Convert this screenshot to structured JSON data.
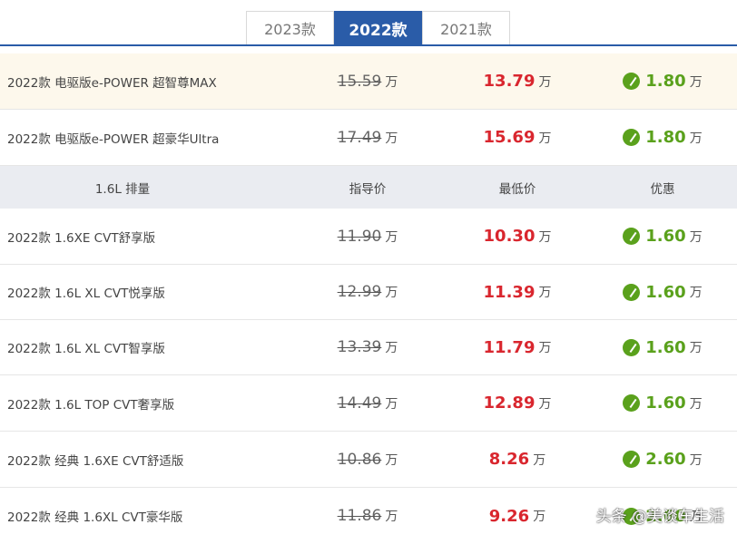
{
  "tabs": [
    {
      "label": "2023款",
      "active": false
    },
    {
      "label": "2022款",
      "active": true
    },
    {
      "label": "2021款",
      "active": false
    }
  ],
  "unit": "万",
  "epower_rows": [
    {
      "name": "2022款 电驱版e-POWER 超智尊MAX",
      "guide_price": "15.59",
      "lowest_price": "13.79",
      "discount": "1.80"
    },
    {
      "name": "2022款 电驱版e-POWER 超豪华Ultra",
      "guide_price": "17.49",
      "lowest_price": "15.69",
      "discount": "1.80"
    }
  ],
  "section_header": {
    "displacement": "1.6L 排量",
    "guide_price": "指导价",
    "lowest_price": "最低价",
    "discount": "优惠"
  },
  "rows": [
    {
      "name": "2022款 1.6XE CVT舒享版",
      "guide_price": "11.90",
      "lowest_price": "10.30",
      "discount": "1.60"
    },
    {
      "name": "2022款 1.6L XL CVT悦享版",
      "guide_price": "12.99",
      "lowest_price": "11.39",
      "discount": "1.60"
    },
    {
      "name": "2022款 1.6L XL CVT智享版",
      "guide_price": "13.39",
      "lowest_price": "11.79",
      "discount": "1.60"
    },
    {
      "name": "2022款 1.6L TOP CVT奢享版",
      "guide_price": "14.49",
      "lowest_price": "12.89",
      "discount": "1.60"
    },
    {
      "name": "2022款 经典 1.6XE CVT舒适版",
      "guide_price": "10.86",
      "lowest_price": "8.26",
      "discount": "2.60"
    },
    {
      "name": "2022款 经典 1.6XL CVT豪华版",
      "guide_price": "11.86",
      "lowest_price": "9.26",
      "discount": "2.60"
    }
  ],
  "watermark": "头条 @美谈车生活",
  "colors": {
    "tab_active": "#2a5ca8",
    "lowest_price": "#d9262e",
    "discount": "#5aa11c",
    "highlight_row": "#fdf8ec",
    "section_header_bg": "#eaecf1"
  }
}
